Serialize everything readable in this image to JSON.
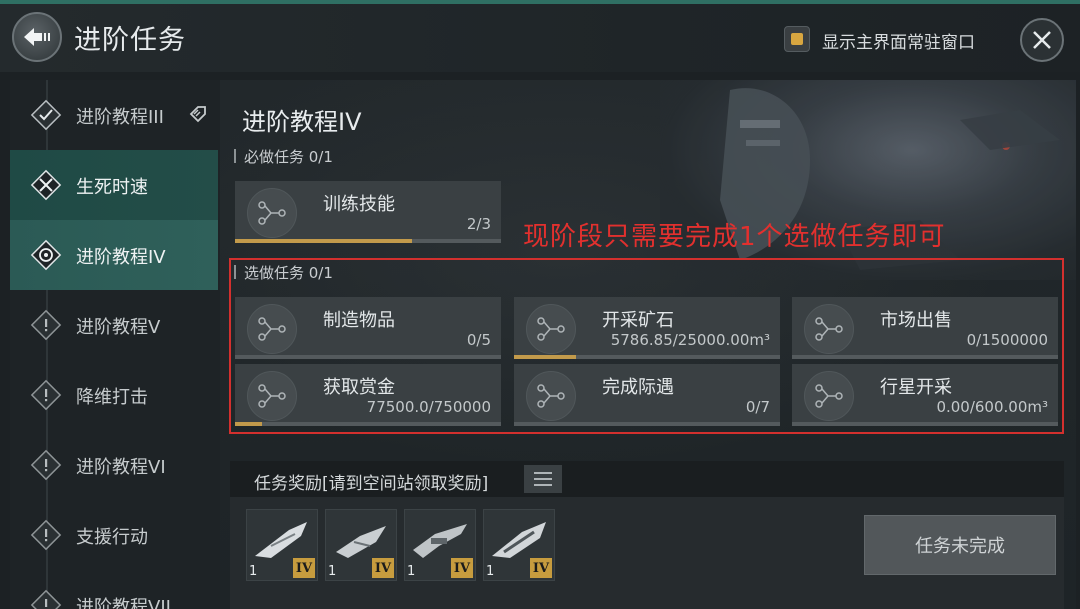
{
  "header": {
    "title": "进阶任务",
    "pin_toggle_label": "显示主界面常驻窗口"
  },
  "sidebar": {
    "items": [
      {
        "label": "进阶教程III",
        "state": "completed"
      },
      {
        "label": "生死时速",
        "state": "active"
      },
      {
        "label": "进阶教程IV",
        "state": "selected"
      },
      {
        "label": "进阶教程V",
        "state": "locked"
      },
      {
        "label": "降维打击",
        "state": "locked"
      },
      {
        "label": "进阶教程VI",
        "state": "locked"
      },
      {
        "label": "支援行动",
        "state": "locked"
      },
      {
        "label": "进阶教程VII",
        "state": "locked"
      }
    ]
  },
  "main": {
    "stage_title": "进阶教程IV",
    "required": {
      "label": "必做任务   0/1",
      "tasks": [
        {
          "name": "训练技能",
          "progress": "2/3",
          "fraction": 0.6667
        }
      ]
    },
    "notice": "现阶段只需要完成1个选做任务即可",
    "optional": {
      "label": "选做任务   0/1",
      "tasks": [
        {
          "name": "制造物品",
          "progress": "0/5",
          "fraction": 0
        },
        {
          "name": "开采矿石",
          "progress": "5786.85/25000.00m³",
          "fraction": 0.2315
        },
        {
          "name": "市场出售",
          "progress": "0/1500000",
          "fraction": 0
        },
        {
          "name": "获取赏金",
          "progress": "77500.0/750000",
          "fraction": 0.1033
        },
        {
          "name": "完成际遇",
          "progress": "0/7",
          "fraction": 0
        },
        {
          "name": "行星开采",
          "progress": "0.00/600.00m³",
          "fraction": 0
        }
      ]
    },
    "rewards": {
      "title": "任务奖励[请到空间站领取奖励]",
      "items": [
        {
          "count": "1",
          "tier": "IV"
        },
        {
          "count": "1",
          "tier": "IV"
        },
        {
          "count": "1",
          "tier": "IV"
        },
        {
          "count": "1",
          "tier": "IV"
        }
      ]
    },
    "status_button": "任务未完成"
  },
  "colors": {
    "accent_gold": "#c29a4b",
    "active_teal": "#234d48",
    "notice_red": "#e2302e"
  }
}
